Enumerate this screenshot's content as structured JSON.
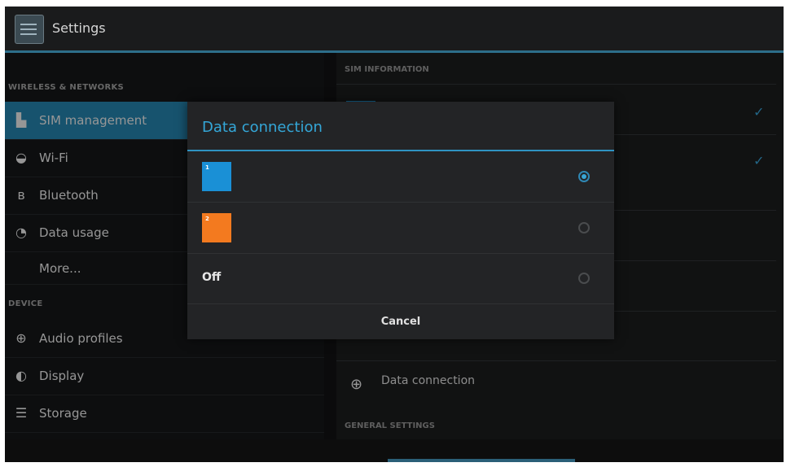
{
  "actionbar": {
    "title": "Settings",
    "icon": "settings-app-icon"
  },
  "left_pane": {
    "sections": [
      {
        "header": "WIRELESS & NETWORKS",
        "items": [
          {
            "label": "SIM management",
            "icon": "sim-card-icon",
            "selected": true
          },
          {
            "label": "Wi-Fi",
            "icon": "wifi-icon"
          },
          {
            "label": "Bluetooth",
            "icon": "bluetooth-icon"
          },
          {
            "label": "Data usage",
            "icon": "data-usage-icon"
          },
          {
            "label": "More...",
            "icon": ""
          }
        ]
      },
      {
        "header": "DEVICE",
        "items": [
          {
            "label": "Audio profiles",
            "icon": "audio-profiles-icon"
          },
          {
            "label": "Display",
            "icon": "display-icon"
          },
          {
            "label": "Storage",
            "icon": "storage-icon"
          }
        ]
      }
    ]
  },
  "right_pane": {
    "sim_info_header": "SIM INFORMATION",
    "data_connection_label": "Data connection",
    "general_settings_header": "GENERAL SETTINGS"
  },
  "dialog": {
    "title": "Data connection",
    "options": [
      {
        "label": "",
        "type": "sim",
        "sim_text": "1",
        "color": "#1a90d6",
        "selected": true
      },
      {
        "label": "",
        "type": "sim",
        "sim_text": "2",
        "color": "#f37a1f",
        "selected": false
      },
      {
        "label": "Off",
        "type": "text",
        "selected": false
      }
    ],
    "cancel_label": "Cancel"
  },
  "colors": {
    "accent": "#34a7d8",
    "selected_bg": "#1f6f93",
    "sim1": "#1a90d6",
    "sim2": "#f37a1f"
  }
}
